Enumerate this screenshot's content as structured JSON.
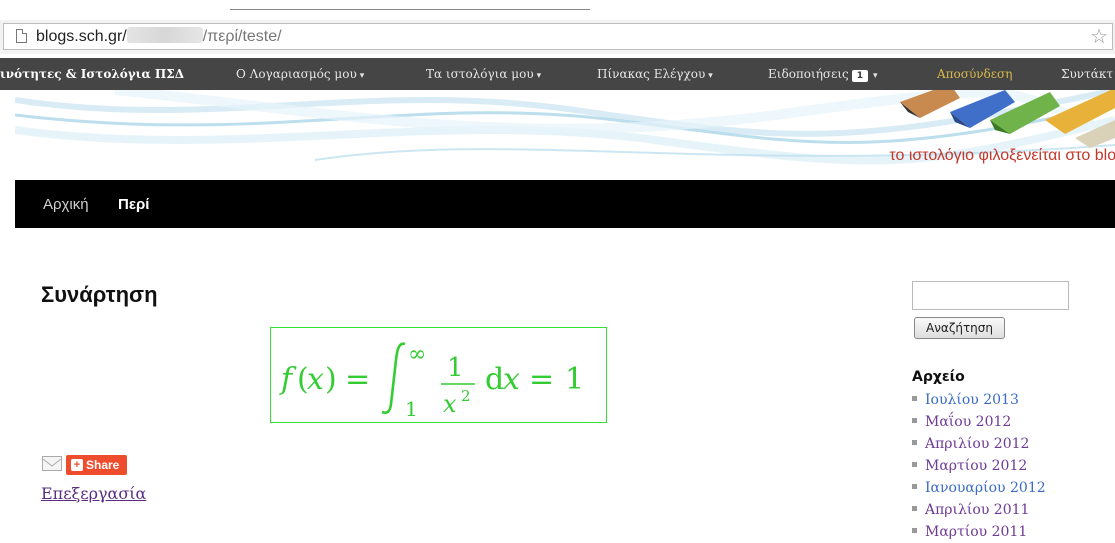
{
  "browser": {
    "url_host": "blogs.sch.gr/",
    "url_path": "/περί/teste/"
  },
  "adminbar": {
    "items": [
      {
        "label": "ινότητες & Ιστολόγια ΠΣΔ"
      },
      {
        "label": "Ο Λογαριασμός μου"
      },
      {
        "label": "Τα ιστολόγια μου"
      },
      {
        "label": "Πίνακας Ελέγχου"
      },
      {
        "label": "Ειδοποιήσεις",
        "badge": "1"
      },
      {
        "label": "Αποσύνδεση"
      },
      {
        "label": "Συντάκτ"
      }
    ]
  },
  "header": {
    "tagline": "το ιστολόγιο φιλοξενείται στο blog"
  },
  "nav": {
    "items": [
      {
        "label": "Αρχική"
      },
      {
        "label": "Περί"
      }
    ]
  },
  "post": {
    "title": "Συνάρτηση",
    "share_label": "Share",
    "edit_label": "Επεξεργασία"
  },
  "sidebar": {
    "search_button": "Αναζήτηση",
    "archive_title": "Αρχείο",
    "archive_items": [
      "Ιουλίου 2013",
      "Μαΐου 2012",
      "Απριλίου 2012",
      "Μαρτίου 2012",
      "Ιανουαρίου 2012",
      "Απριλίου 2011",
      "Μαρτίου 2011"
    ]
  },
  "colors": {
    "admin_bar": "#454545",
    "nav_bar": "#000000",
    "formula_green": "#33e133",
    "tagline_red": "#c0392b",
    "share_orange": "#ee4d2d",
    "link_blue": "#3a6bc4",
    "link_visited": "#6d3a94"
  }
}
